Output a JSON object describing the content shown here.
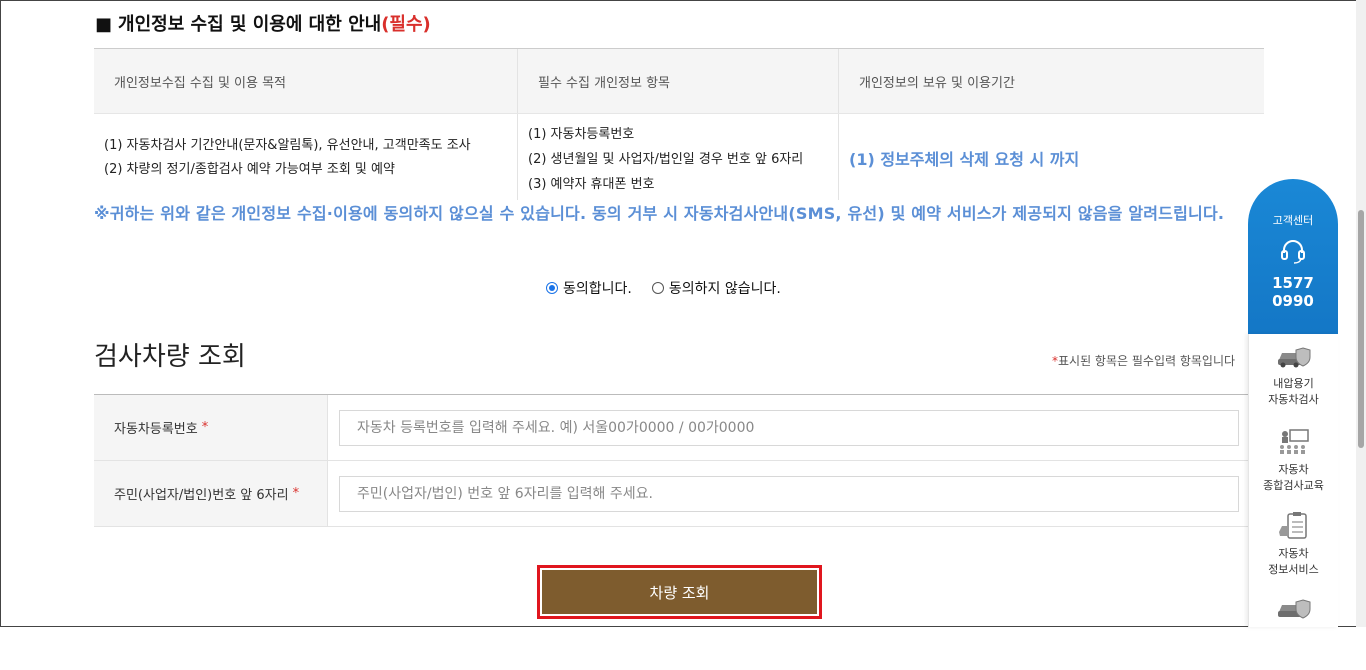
{
  "privacy": {
    "title_prefix": "■",
    "title": "개인정보 수집 및 이용에 대한 안내",
    "title_required": "(필수)",
    "table": {
      "headers": [
        "개인정보수집 수집 및 이용 목적",
        "필수 수집 개인정보 항목",
        "개인정보의 보유 및 이용기간"
      ],
      "purposes": [
        "(1) 자동차검사 기간안내(문자&알림톡), 유선안내, 고객만족도 조사",
        "(2) 차량의 정기/종합검사 예약 가능여부 조회 및 예약"
      ],
      "items": [
        "(1) 자동차등록번호",
        "(2) 생년월일 및 사업자/법인일 경우 번호 앞 6자리",
        "(3) 예약자 휴대폰 번호"
      ],
      "retention": "(1) 정보주체의 삭제 요청 시 까지"
    },
    "notice": "※귀하는 위와 같은 개인정보 수집·이용에 동의하지 않으실 수 있습니다. 동의 거부 시 자동차검사안내(SMS, 유선) 및 예약 서비스가 제공되지 않음을 알려드립니다.",
    "agree_label": "동의합니다.",
    "disagree_label": "동의하지 않습니다.",
    "selected": "agree"
  },
  "lookup": {
    "title": "검사차량 조회",
    "required_note_star": "*",
    "required_note": "표시된 항목은 필수입력 항목입니다",
    "fields": [
      {
        "label": "자동차등록번호",
        "star": "*",
        "value": "",
        "placeholder": "자동차 등록번호를 입력해 주세요. 예) 서울00가0000 / 00가0000"
      },
      {
        "label": "주민(사업자/법인)번호 앞 6자리",
        "star": "*",
        "value": "",
        "placeholder": "주민(사업자/법인) 번호 앞 6자리를 입력해 주세요."
      }
    ],
    "submit_label": "차량 조회"
  },
  "sidebar": {
    "cs_title": "고객센터",
    "cs_phone_line1": "1577",
    "cs_phone_line2": "0990",
    "items": [
      {
        "line1": "내압용기",
        "line2": "자동차검사",
        "icon": "car-shield-icon"
      },
      {
        "line1": "자동차",
        "line2": "종합검사교육",
        "icon": "lecture-icon"
      },
      {
        "line1": "자동차",
        "line2": "정보서비스",
        "icon": "clipboard-icon"
      }
    ]
  },
  "colors": {
    "accent_blue": "#5b8fd6",
    "required_red": "#d9302c",
    "button_brown": "#7e5c2e",
    "cs_blue": "#1a88d6",
    "highlight_red": "#e0161e"
  }
}
